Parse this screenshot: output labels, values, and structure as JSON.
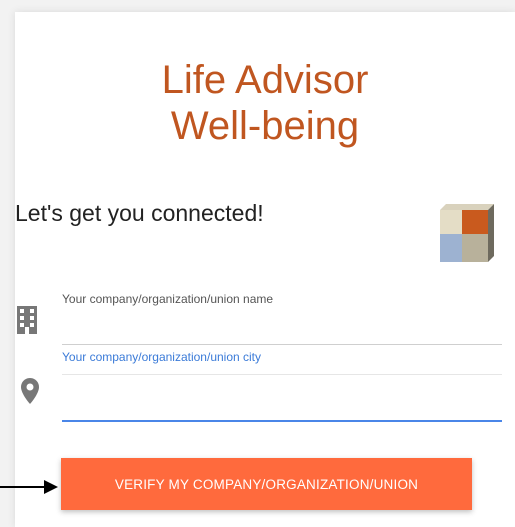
{
  "app": {
    "title_line1": "Life Advisor",
    "title_line2": "Well-being",
    "brand_color": "#c05620"
  },
  "form": {
    "heading": "Let's get you connected!",
    "company_field": {
      "label": "Your company/organization/union name",
      "value": "",
      "icon": "building-icon"
    },
    "city_field": {
      "label": "Your company/organization/union city",
      "value": "",
      "icon": "map-pin-icon",
      "focused": true
    },
    "verify_button_label": "VERIFY MY COMPANY/ORGANIZATION/UNION",
    "button_color": "#ff6a3d",
    "focus_color": "#4a86e8"
  }
}
